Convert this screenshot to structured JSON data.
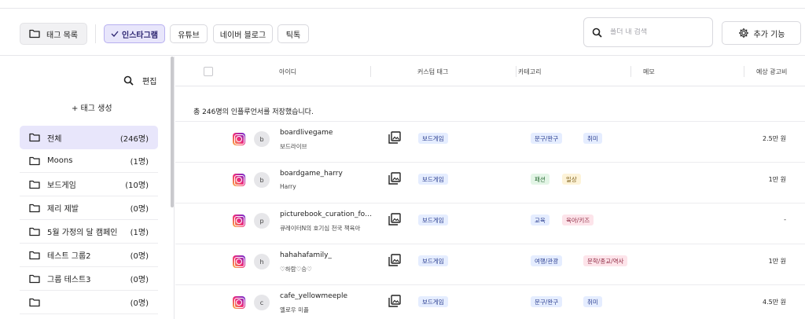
{
  "toolbar": {
    "tag_list": "태그 목록",
    "platforms": {
      "instagram": "인스타그램",
      "youtube": "유튜브",
      "naver_blog": "네이버 블로그",
      "tiktok": "틱톡"
    },
    "search_placeholder": "폴더 내 검색",
    "more_features": "추가 기능"
  },
  "sidebar": {
    "edit": "편집",
    "create_tag": "+ 태그 생성",
    "folders": [
      {
        "name": "전체",
        "count": "(246명)"
      },
      {
        "name": "Moons",
        "count": "(1명)"
      },
      {
        "name": "보드게임",
        "count": "(10명)"
      },
      {
        "name": "제리 제발",
        "count": "(0명)"
      },
      {
        "name": "5월 가정의 달 캠페인",
        "count": "(1명)"
      },
      {
        "name": "테스트 그룹2",
        "count": "(0명)"
      },
      {
        "name": "그룹 테스트3",
        "count": "(0명)"
      },
      {
        "name": "",
        "count": "(0명)"
      }
    ]
  },
  "table": {
    "headers": {
      "id": "아이디",
      "custom_tag": "커스텀 태그",
      "category": "카테고리",
      "memo": "메모",
      "est_ad_cost": "예상 광고비"
    },
    "total_text": "총 246명의 인플루언서를 저장했습니다.",
    "rows": [
      {
        "avatar": "b",
        "handle": "boardlivegame",
        "name": "보드라이브",
        "custom_tag": "보드게임",
        "categories": [
          {
            "label": "문구/완구",
            "color": "#e5edff",
            "text": "#2a3d8f"
          },
          {
            "label": "취미",
            "color": "#e5edff",
            "text": "#2a3d8f"
          }
        ],
        "price": "2.5만 원"
      },
      {
        "avatar": "b",
        "handle": "boardgame_harry",
        "name": "Harry",
        "custom_tag": "보드게임",
        "categories": [
          {
            "label": "패션",
            "color": "#e3f5e6",
            "text": "#2a6b35"
          },
          {
            "label": "일상",
            "color": "#fdf3d8",
            "text": "#7a5a12"
          }
        ],
        "price": "1만 원"
      },
      {
        "avatar": "p",
        "handle": "picturebook_curation_for_kids",
        "name": "큐레이터N의 호기심 천국 책육아",
        "custom_tag": "보드게임",
        "categories": [
          {
            "label": "교육",
            "color": "#e5edff",
            "text": "#2a3d8f"
          },
          {
            "label": "육아/키즈",
            "color": "#fde4ea",
            "text": "#8f2a43"
          }
        ],
        "price": "-"
      },
      {
        "avatar": "h",
        "handle": "hahahafamily_",
        "name": "♡하람♡승♡",
        "custom_tag": "보드게임",
        "categories": [
          {
            "label": "여행/관광",
            "color": "#e5edff",
            "text": "#2a3d8f"
          },
          {
            "label": "문학/종교/역사",
            "color": "#fde4ea",
            "text": "#8f2a43"
          }
        ],
        "price": "1만 원"
      },
      {
        "avatar": "c",
        "handle": "cafe_yellowmeeple",
        "name": "옐로우 미플",
        "custom_tag": "보드게임",
        "categories": [
          {
            "label": "문구/완구",
            "color": "#e5edff",
            "text": "#2a3d8f"
          },
          {
            "label": "취미",
            "color": "#e5edff",
            "text": "#2a3d8f"
          }
        ],
        "price": "4.5만 원"
      }
    ]
  }
}
